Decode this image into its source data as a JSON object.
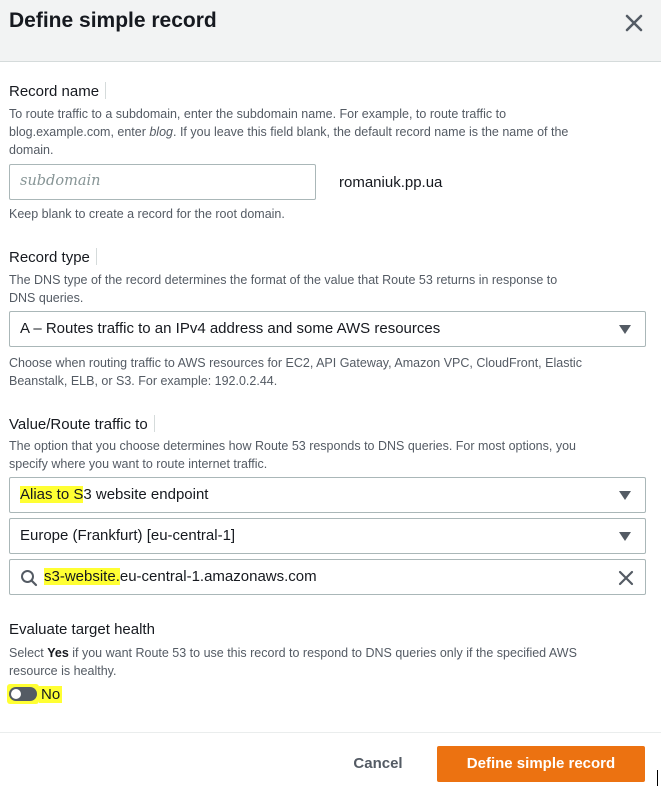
{
  "dialog": {
    "title": "Define simple record"
  },
  "record_name": {
    "label": "Record name",
    "desc_1": "To route traffic to a subdomain, enter the subdomain name. For example, to route traffic to",
    "desc_2a": "blog.example.com, enter ",
    "desc_2b": "blog",
    "desc_2c": ". If you leave this field blank, the default record name is the name of the",
    "desc_3": "domain.",
    "placeholder": "subdomain",
    "value": "",
    "domain_suffix": "romaniuk.pp.ua",
    "hint": "Keep blank to create a record for the root domain."
  },
  "record_type": {
    "label": "Record type",
    "desc_1": "The DNS type of the record determines the format of the value that Route 53 returns in response to",
    "desc_2": "DNS queries.",
    "selected": "A – Routes traffic to an IPv4 address and some AWS resources",
    "hint_1": "Choose when routing traffic to AWS resources for EC2, API Gateway, Amazon VPC, CloudFront, Elastic",
    "hint_2": "Beanstalk, ELB, or S3. For example: 192.0.2.44."
  },
  "route_traffic": {
    "label": "Value/Route traffic to",
    "desc_1": "The option that you choose determines how Route 53 responds to DNS queries. For most options, you",
    "desc_2": "specify where you want to route internet traffic.",
    "endpoint_type_hl": "Alias to S",
    "endpoint_type_rest": "3 website endpoint",
    "region": "Europe (Frankfurt) [eu-central-1]",
    "endpoint_hl": "s3-website.",
    "endpoint_rest": "eu-central-1.amazonaws.com"
  },
  "health": {
    "label": "Evaluate target health",
    "desc_1a": "Select ",
    "desc_1b": "Yes",
    "desc_1c": " if you want Route 53 to use this record to respond to DNS queries only if the specified AWS",
    "desc_2": "resource is healthy.",
    "toggle_label": "No",
    "enabled": false
  },
  "footer": {
    "cancel_label": "Cancel",
    "submit_label": "Define simple record"
  },
  "colors": {
    "primary": "#ec7211",
    "highlight": "#ffff33",
    "header_bg": "#f2f3f3"
  },
  "icons": [
    "close-icon",
    "caret-down-icon",
    "search-icon",
    "clear-icon"
  ]
}
